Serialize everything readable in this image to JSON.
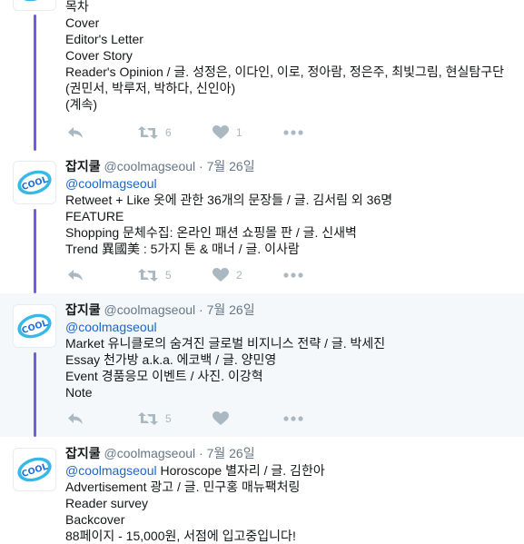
{
  "colors": {
    "thread_line": "#6f5fe0",
    "mention": "#1b66c9",
    "icon": "#aab8c2",
    "highlight_bg": "#f5f8fa"
  },
  "icons": {
    "reply": "reply-icon",
    "retweet": "retweet-icon",
    "like": "heart-icon",
    "more": "more-icon",
    "avatar": "cool-logo"
  },
  "avatar_text": "COOL",
  "tweets": [
    {
      "lines": [
        "목차",
        "Cover",
        "Editor's Letter",
        "Cover Story",
        "Reader's Opinion  / 글. 성정은, 이다인, 이로, 정아람, 정은주, 최빛그림, 현실탐구단(권민서, 박루저, 박하다, 신인아)",
        "(계속)"
      ],
      "retweets": "6",
      "likes": "1"
    },
    {
      "name": "잡지쿨",
      "handle": "@coolmagseoul",
      "sep": "·",
      "time": "7월 26일",
      "mention": "@coolmagseoul",
      "lines": [
        "Retweet + Like  옷에 관한 36개의 문장들 / 글. 김서림 외 36명",
        "FEATURE",
        "Shopping  문체수집: 온라인 패션 쇼핑몰 판 / 글. 신새벽",
        "Trend  異國美 : 5가지 톤 & 매너 / 글. 이사람"
      ],
      "retweets": "5",
      "likes": "2"
    },
    {
      "name": "잡지쿨",
      "handle": "@coolmagseoul",
      "sep": "·",
      "time": "7월 26일",
      "mention": "@coolmagseoul",
      "lines": [
        "Market  유니클로의 숨겨진 글로벌 비지니스 전략 / 글. 박세진",
        "Essay  천가방 a.k.a. 에코백 / 글. 양민영",
        "Event  경품응모 이벤트 / 사진. 이강혁",
        "Note"
      ],
      "retweets": "5"
    },
    {
      "name": "잡지쿨",
      "handle": "@coolmagseoul",
      "sep": "·",
      "time": "7월 26일",
      "mention": "@coolmagseoul",
      "first_line_rest": " Horoscope  별자리 / 글. 김한아",
      "lines": [
        "Advertisement  광고 / 글. 민구홍 매뉴팩처링",
        "Reader survey",
        "Backcover",
        "88페이지 - 15,000원, 서점에 입고중입니다!"
      ]
    }
  ]
}
